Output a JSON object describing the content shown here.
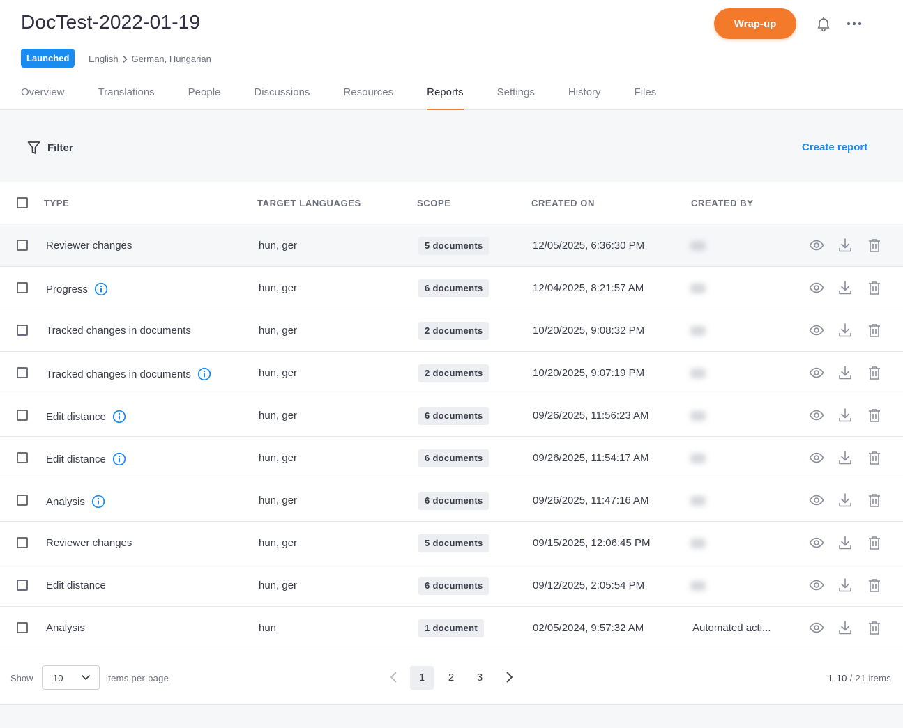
{
  "project": {
    "title": "DocTest-2022-01-19",
    "status": "Launched",
    "source_language": "English",
    "target_languages": "German, Hungarian",
    "wrapup_label": "Wrap-up",
    "accent_color": "#f47a2b",
    "link_color": "#1a8cf0"
  },
  "tabs": [
    {
      "label": "Overview"
    },
    {
      "label": "Translations"
    },
    {
      "label": "People"
    },
    {
      "label": "Discussions"
    },
    {
      "label": "Resources"
    },
    {
      "label": "Reports",
      "active": true
    },
    {
      "label": "Settings"
    },
    {
      "label": "History"
    },
    {
      "label": "Files"
    }
  ],
  "toolbar": {
    "filter_label": "Filter",
    "create_report_label": "Create report"
  },
  "table": {
    "headers": {
      "type": "TYPE",
      "target_languages": "TARGET LANGUAGES",
      "scope": "SCOPE",
      "created_on": "CREATED ON",
      "created_by": "CREATED BY"
    },
    "rows": [
      {
        "type": "Reviewer changes",
        "info": false,
        "languages": "hun, ger",
        "scope": "5 documents",
        "created_on": "12/05/2025, 6:36:30 PM",
        "created_by": ""
      },
      {
        "type": "Progress",
        "info": true,
        "languages": "hun, ger",
        "scope": "6 documents",
        "created_on": "12/04/2025, 8:21:57 AM",
        "created_by": ""
      },
      {
        "type": "Tracked changes in documents",
        "info": false,
        "languages": "hun, ger",
        "scope": "2 documents",
        "created_on": "10/20/2025, 9:08:32 PM",
        "created_by": ""
      },
      {
        "type": "Tracked changes in documents",
        "info": true,
        "languages": "hun, ger",
        "scope": "2 documents",
        "created_on": "10/20/2025, 9:07:19 PM",
        "created_by": ""
      },
      {
        "type": "Edit distance",
        "info": true,
        "languages": "hun, ger",
        "scope": "6 documents",
        "created_on": "09/26/2025, 11:56:23 AM",
        "created_by": ""
      },
      {
        "type": "Edit distance",
        "info": true,
        "languages": "hun, ger",
        "scope": "6 documents",
        "created_on": "09/26/2025, 11:54:17 AM",
        "created_by": ""
      },
      {
        "type": "Analysis",
        "info": true,
        "languages": "hun, ger",
        "scope": "6 documents",
        "created_on": "09/26/2025, 11:47:16 AM",
        "created_by": ""
      },
      {
        "type": "Reviewer changes",
        "info": false,
        "languages": "hun, ger",
        "scope": "5 documents",
        "created_on": "09/15/2025, 12:06:45 PM",
        "created_by": ""
      },
      {
        "type": "Edit distance",
        "info": false,
        "languages": "hun, ger",
        "scope": "6 documents",
        "created_on": "09/12/2025, 2:05:54 PM",
        "created_by": ""
      },
      {
        "type": "Analysis",
        "info": false,
        "languages": "hun",
        "scope": "1 document",
        "created_on": "02/05/2024, 9:57:32 AM",
        "created_by": "Automated acti..."
      }
    ]
  },
  "pagination": {
    "show_label": "Show",
    "per_page": "10",
    "items_per_page_label": "items per page",
    "pages": [
      "1",
      "2",
      "3"
    ],
    "current_page": "1",
    "range": "1-10",
    "total": "21 items"
  }
}
